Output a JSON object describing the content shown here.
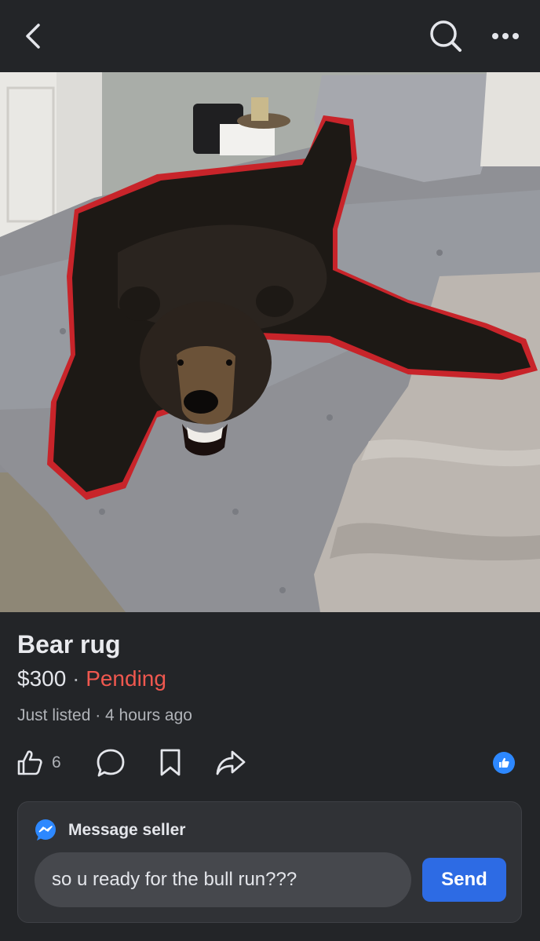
{
  "header": {
    "back_icon": "chevron-left-icon",
    "search_icon": "search-icon",
    "more_icon": "more-horizontal-icon"
  },
  "listing": {
    "title": "Bear rug",
    "price": "$300",
    "separator": "·",
    "status": "Pending",
    "listed_time": "Just listed · 4 hours ago"
  },
  "actions": {
    "like_count": "6",
    "like_icon": "thumbs-up-icon",
    "comment_icon": "comment-icon",
    "save_icon": "bookmark-icon",
    "share_icon": "share-icon",
    "reaction_icon": "like-reaction-icon"
  },
  "message": {
    "header_label": "Message seller",
    "icon": "messenger-icon",
    "input_value": "so u ready for the bull run???",
    "send_label": "Send"
  },
  "colors": {
    "background": "#232528",
    "status_pending": "#f0584f",
    "send_button": "#2d6be4",
    "like_badge": "#2d88ff",
    "muted_text": "#b0b3b8"
  }
}
